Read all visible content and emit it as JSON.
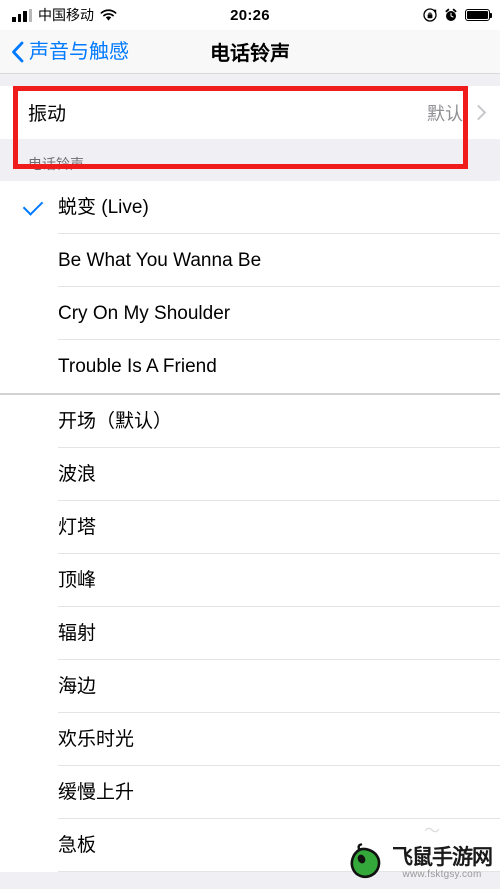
{
  "status_bar": {
    "carrier": "中国移动",
    "time": "20:26",
    "icons": [
      "signal-bars-icon",
      "wifi-icon",
      "rotation-lock-icon",
      "alarm-clock-icon",
      "battery-icon"
    ]
  },
  "nav_bar": {
    "back_label": "声音与触感",
    "back_icon": "chevron-left-icon",
    "title": "电话铃声",
    "accent_color": "#007aff"
  },
  "vibration": {
    "label": "振动",
    "value": "默认",
    "chevron": "chevron-right-icon"
  },
  "annotation": {
    "color": "#f01c1c",
    "target": "vibration-row"
  },
  "section": {
    "header": "电话铃声"
  },
  "ringtones": {
    "custom": [
      {
        "label": "蜕变 (Live)",
        "selected": true
      },
      {
        "label": "Be What You Wanna Be",
        "selected": false
      },
      {
        "label": "Cry On My Shoulder",
        "selected": false
      },
      {
        "label": "Trouble Is A Friend",
        "selected": false
      }
    ],
    "builtin": [
      {
        "label": "开场（默认）",
        "selected": false
      },
      {
        "label": "波浪",
        "selected": false
      },
      {
        "label": "灯塔",
        "selected": false
      },
      {
        "label": "顶峰",
        "selected": false
      },
      {
        "label": "辐射",
        "selected": false
      },
      {
        "label": "海边",
        "selected": false
      },
      {
        "label": "欢乐时光",
        "selected": false
      },
      {
        "label": "缓慢上升",
        "selected": false
      },
      {
        "label": "急板",
        "selected": false
      }
    ]
  },
  "watermark": {
    "name": "飞鼠手游网",
    "url": "www.fsktgsy.com",
    "logo_icon": "mouse-icon",
    "logo_color": "#34a83a"
  }
}
